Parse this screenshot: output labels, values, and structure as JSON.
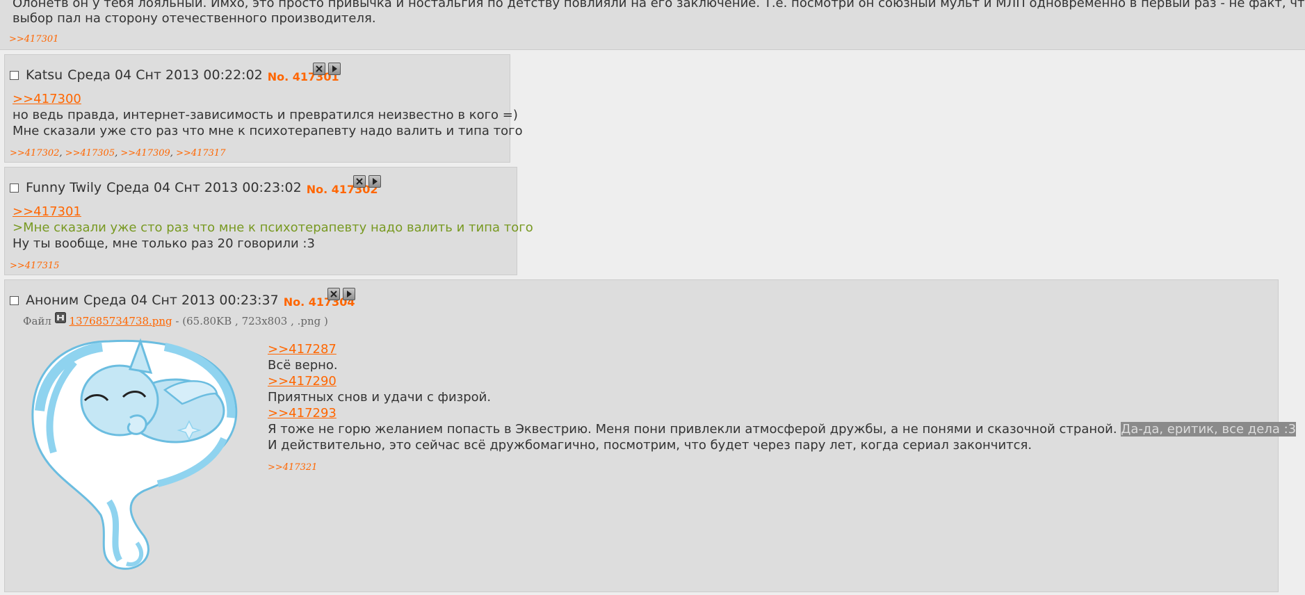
{
  "top_post": {
    "line1": "Олонетв он у тебя лояльный. Имхо, это просто привычка и ностальгия по детству повлияли на его заключение. Т.е. посмотри он союзный мульт и МЛП одновременно в первый раз - не факт, что",
    "line2": "выбор пал на сторону отечественного производителя.",
    "replies": [
      ">>417301"
    ]
  },
  "posts": [
    {
      "name": "Katsu",
      "date": "Среда 04 Снт 2013 00:22:02",
      "number": "No. 417301",
      "quote_link": ">>417300",
      "lines": [
        "но ведь правда, интернет-зависимость и превратился неизвестно в кого =)",
        "Мне сказали уже сто раз что мне к психотерапевту надо валить и типа того"
      ],
      "replies": [
        ">>417302",
        ">>417305",
        ">>417309",
        ">>417317"
      ]
    },
    {
      "name": "Funny Twily",
      "date": "Среда 04 Снт 2013 00:23:02",
      "number": "No. 417302",
      "quote_link": ">>417301",
      "greentext": ">Мне сказали уже сто раз что мне к психотерапевту надо валить и типа того",
      "lines": [
        "Ну ты вообще, мне только раз 20 говорили :3"
      ],
      "replies": [
        ">>417315"
      ]
    },
    {
      "name": "Аноним",
      "date": "Среда 04 Снт 2013 00:23:37",
      "number": "No. 417304",
      "file_label": "Файл",
      "file_name": "137685734738.png",
      "file_meta": "- (65.80KB , 723x803 , .png )",
      "link1": ">>417287",
      "text1": "Всё верно.",
      "link2": ">>417290",
      "text2": "Приятных снов и удачи с физрой.",
      "link3": ">>417293",
      "text3": "Я тоже не горю желанием попасть в Эквестрию. Меня пони привлекли атмосферой дружбы, а не понями и сказочной страной.",
      "text3_highlight": "Да-да, еритик, все дела :3",
      "text4": "И действительно, это сейчас всё дружбомагично, посмотрим, что будет через пару лет, когда сериал закончится.",
      "replies": [
        ">>417321"
      ]
    }
  ],
  "colors": {
    "link": "#ff6600",
    "greentext": "#789922",
    "post_bg": "#dddddd",
    "page_bg": "#eeeeee"
  },
  "icons": [
    "delete-icon",
    "play-icon",
    "file-icon"
  ]
}
